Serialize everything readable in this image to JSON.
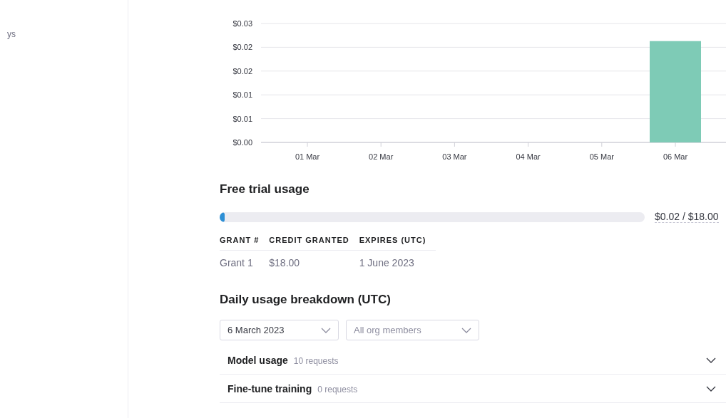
{
  "sidebar": {
    "items": [
      {
        "label": "ys"
      }
    ]
  },
  "usage_chart": {
    "chart_data": {
      "type": "bar",
      "categories": [
        "01 Mar",
        "02 Mar",
        "03 Mar",
        "04 Mar",
        "05 Mar",
        "06 Mar"
      ],
      "values": [
        0,
        0,
        0,
        0,
        0,
        0.0213
      ],
      "grid": true,
      "ylim": [
        0,
        0.025
      ],
      "yticks": [
        {
          "value": 0,
          "label": "$0.00"
        },
        {
          "value": 0.005,
          "label": "$0.01"
        },
        {
          "value": 0.01,
          "label": "$0.01"
        },
        {
          "value": 0.015,
          "label": "$0.02"
        },
        {
          "value": 0.02,
          "label": "$0.02"
        },
        {
          "value": 0.025,
          "label": "$0.03"
        }
      ]
    }
  },
  "free_trial": {
    "title": "Free trial usage",
    "level": 0.011,
    "reading": "$0.02 / $18.00",
    "table": {
      "columns": [
        "GRANT #",
        "CREDIT GRANTED",
        "EXPIRES (UTC)"
      ],
      "rows": [
        [
          "Grant 1",
          "$18.00",
          "1 June 2023"
        ]
      ]
    }
  },
  "breakdown": {
    "title": "Daily usage breakdown (UTC)",
    "filters": [
      {
        "value": "6 March 2023"
      },
      {
        "placeholder": "All org members"
      }
    ],
    "sections": [
      {
        "title": "Model usage",
        "count": "10 requests",
        "expanded": false
      },
      {
        "title": "Fine-tune training",
        "count": "0 requests",
        "expanded": false
      }
    ]
  }
}
